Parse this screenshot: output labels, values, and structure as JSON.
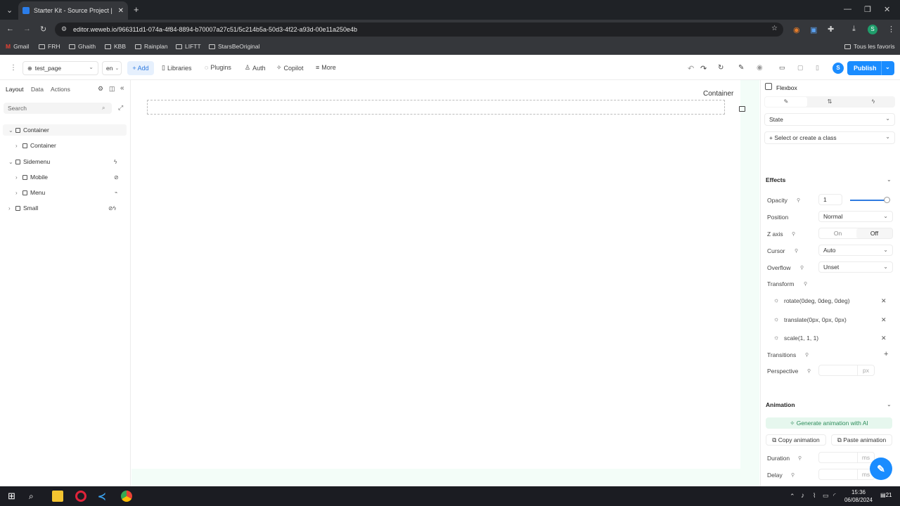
{
  "browser": {
    "tab_title": "Starter Kit - Source Project | We",
    "url": "editor.weweb.io/966311d1-074a-4f84-8894-b70007a27c51/5c214b5a-50d3-4f22-a93d-00e11a250e4b",
    "bookmarks": [
      "Gmail",
      "FRH",
      "Ghaith",
      "KBB",
      "Rainplan",
      "LIFTT",
      "StarsBeOriginal"
    ],
    "all_bookmarks": "Tous les favoris",
    "profile_letter": "S"
  },
  "toolbar": {
    "page": "test_page",
    "lang": "en",
    "add": "+ Add",
    "libraries": "Libraries",
    "plugins": "Plugins",
    "auth": "Auth",
    "copilot": "Copilot",
    "more": "More",
    "avatar": "S",
    "publish": "Publish"
  },
  "left_panel": {
    "tabs": [
      "Layout",
      "Data",
      "Actions"
    ],
    "search_placeholder": "Search",
    "tree": [
      {
        "label": "Container",
        "depth": 0
      },
      {
        "label": "Container",
        "depth": 1
      },
      {
        "label": "Sidemenu",
        "depth": 0
      },
      {
        "label": "Mobile",
        "depth": 1
      },
      {
        "label": "Menu",
        "depth": 1
      },
      {
        "label": "Small",
        "depth": 0
      }
    ]
  },
  "canvas": {
    "selected_label": "Container"
  },
  "right_panel": {
    "component": "Flexbox",
    "state": "State",
    "class_select": "+ Select or create a class",
    "effects_title": "Effects",
    "opacity_label": "Opacity",
    "opacity_value": "1",
    "opacity_level": 1.0,
    "position_label": "Position",
    "position_value": "Normal",
    "zaxis_label": "Z axis",
    "zaxis_on": "On",
    "zaxis_off": "Off",
    "cursor_label": "Cursor",
    "cursor_value": "Auto",
    "overflow_label": "Overflow",
    "overflow_value": "Unset",
    "transform_label": "Transform",
    "transforms": [
      "rotate(0deg, 0deg, 0deg)",
      "translate(0px, 0px, 0px)",
      "scale(1, 1, 1)"
    ],
    "transitions_label": "Transitions",
    "perspective_label": "Perspective",
    "perspective_unit": "px",
    "animation_title": "Animation",
    "generate_ai": "Generate animation with AI",
    "copy_animation": "Copy animation",
    "paste_animation": "Paste animation",
    "duration_label": "Duration",
    "duration_unit": "ms",
    "delay_label": "Delay",
    "delay_unit": "ms"
  },
  "taskbar": {
    "time": "15:36",
    "date": "06/08/2024",
    "notification_count": "21"
  }
}
